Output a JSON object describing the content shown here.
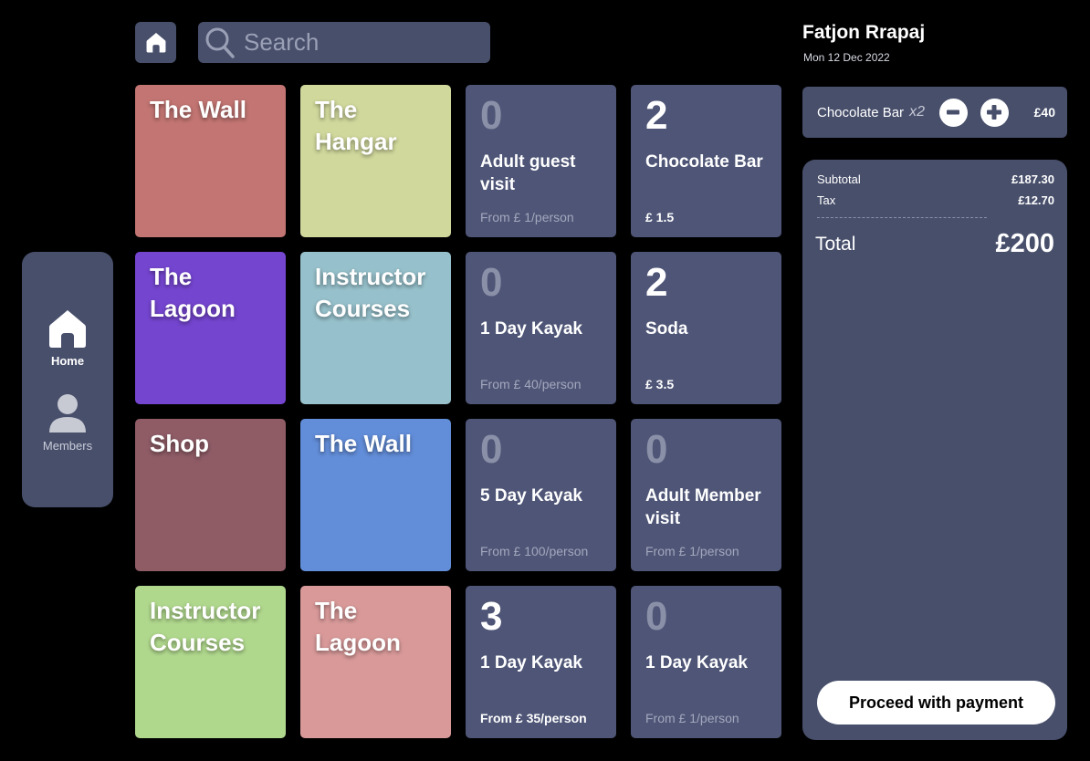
{
  "sidebar": {
    "items": [
      {
        "label": "Home",
        "icon": "home-icon",
        "active": true
      },
      {
        "label": "Members",
        "icon": "person-icon",
        "active": false
      }
    ]
  },
  "topbar": {
    "home_icon": "home-icon",
    "search_icon": "search-icon",
    "search_placeholder": "Search"
  },
  "categories": [
    {
      "label": "The Wall",
      "color": "#c27572"
    },
    {
      "label": "The Hangar",
      "color": "#d1d89c"
    },
    {
      "label": "The Lagoon",
      "color": "#7445cf"
    },
    {
      "label": "Instructor Courses",
      "color": "#96c0cb"
    },
    {
      "label": "Shop",
      "color": "#8f5c66"
    },
    {
      "label": "The Wall",
      "color": "#628dd8"
    },
    {
      "label": "Instructor Courses",
      "color": "#b0d88d"
    },
    {
      "label": "The Lagoon",
      "color": "#d99999"
    }
  ],
  "products": [
    {
      "qty": "0",
      "name": "Adult guest visit",
      "price": "From  £ 1/person"
    },
    {
      "qty": "2",
      "name": "Chocolate Bar",
      "price": "£ 1.5"
    },
    {
      "qty": "0",
      "name": "1 Day Kayak",
      "price": "From  £ 40/person"
    },
    {
      "qty": "2",
      "name": "Soda",
      "price": "£ 3.5"
    },
    {
      "qty": "0",
      "name": "5 Day Kayak",
      "price": "From  £ 100/person"
    },
    {
      "qty": "0",
      "name": "Adult Member visit",
      "price": "From  £ 1/person"
    },
    {
      "qty": "3",
      "name": "1 Day Kayak",
      "price": "From  £ 35/person"
    },
    {
      "qty": "0",
      "name": "1 Day Kayak",
      "price": "From  £ 1/person"
    }
  ],
  "user": {
    "name": "Fatjon Rrapaj",
    "date": "Mon 12 Dec 2022"
  },
  "cart": {
    "items": [
      {
        "name": "Chocolate Bar",
        "multiplier": "x2",
        "price": "£40",
        "minus_icon": "minus-icon",
        "plus_icon": "plus-icon"
      }
    ]
  },
  "summary": {
    "subtotal_label": "Subtotal",
    "subtotal_value": "£187.30",
    "tax_label": "Tax",
    "tax_value": "£12.70",
    "total_label": "Total",
    "total_value": "£200",
    "pay_label": "Proceed with payment"
  },
  "colors": {
    "background": "#000000",
    "panel": "#484f6b",
    "product_tile": "#4e5576",
    "muted_text": "#a3a8bd"
  }
}
